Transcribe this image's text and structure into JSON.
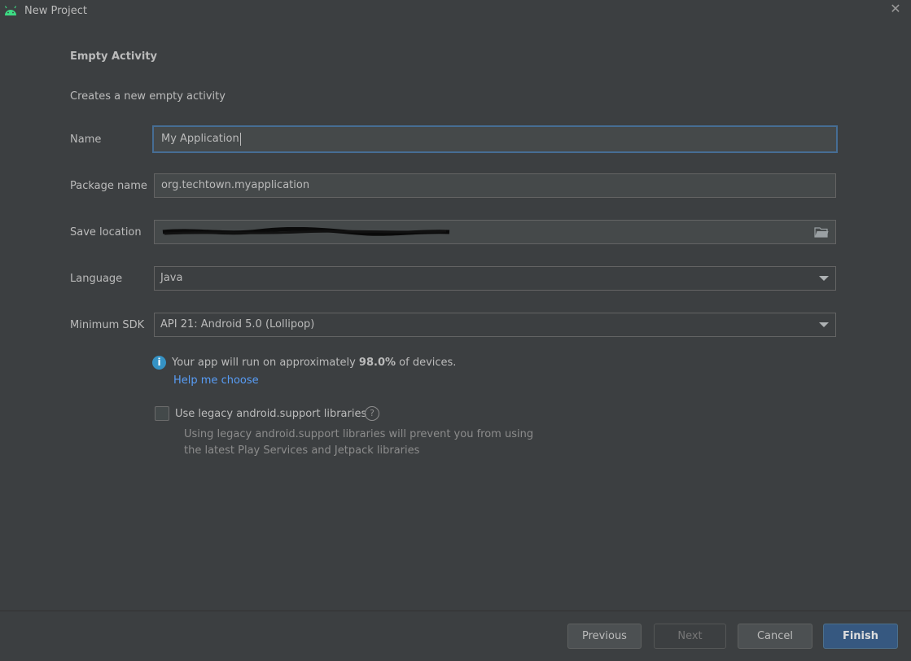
{
  "window": {
    "title": "New Project",
    "app_icon": "android-icon",
    "close_icon": "close-icon"
  },
  "template": {
    "heading": "Empty Activity",
    "description": "Creates a new empty activity"
  },
  "form": {
    "name_label": "Name",
    "name_value": "My Application",
    "package_label": "Package name",
    "package_value": "org.techtown.myapplication",
    "save_location_label": "Save location",
    "save_location_value": "",
    "language_label": "Language",
    "language_value": "Java",
    "min_sdk_label": "Minimum SDK",
    "min_sdk_value": "API 21: Android 5.0 (Lollipop)"
  },
  "info": {
    "text_before": "Your app will run on approximately ",
    "percentage": "98.0%",
    "text_after": " of devices.",
    "help_link": "Help me choose"
  },
  "legacy": {
    "checkbox_label": "Use legacy android.support libraries",
    "checked": false,
    "hint_line1": "Using legacy android.support libraries will prevent you from using",
    "hint_line2": "the latest Play Services and Jetpack libraries"
  },
  "buttons": {
    "previous": "Previous",
    "next": "Next",
    "cancel": "Cancel",
    "finish": "Finish"
  },
  "colors": {
    "background": "#3c3f41",
    "accent_link": "#589df6",
    "primary_button": "#365880",
    "android_green": "#3ddc84"
  }
}
